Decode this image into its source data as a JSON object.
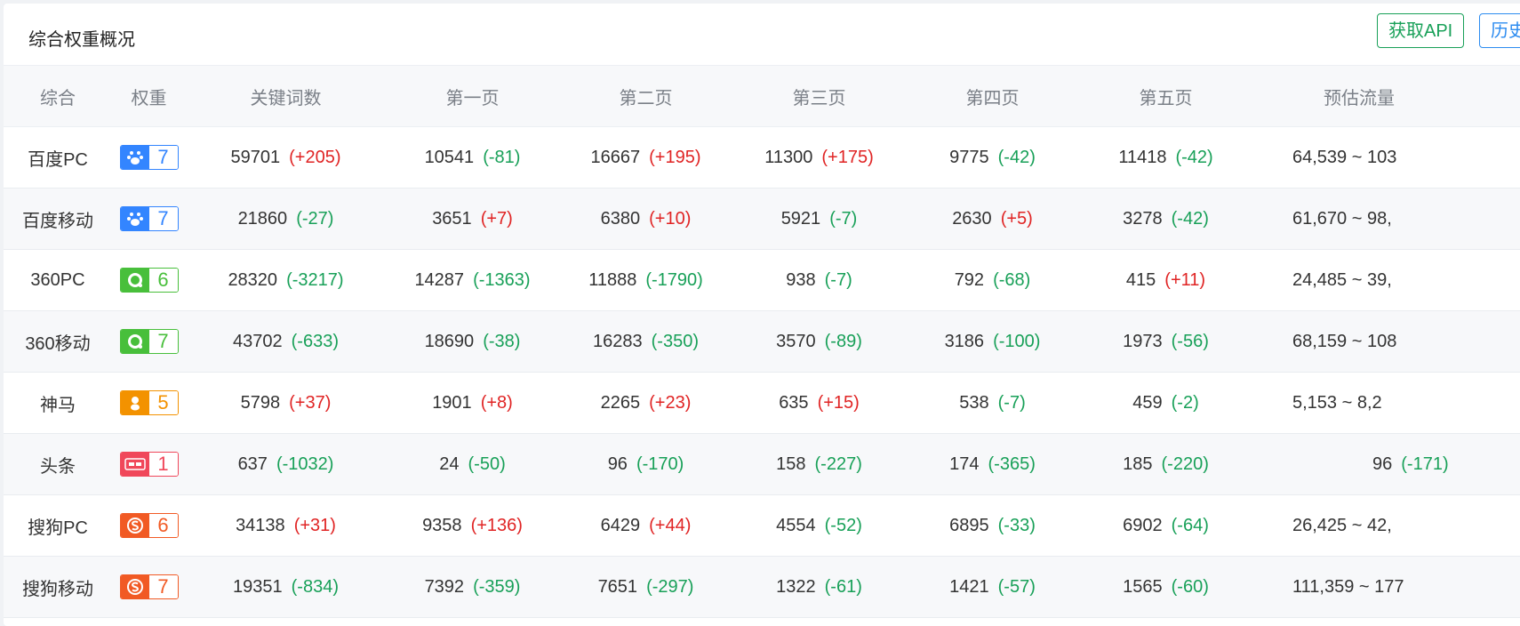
{
  "header": {
    "title": "综合权重概况",
    "api_button": "获取API",
    "history_button": "历史"
  },
  "table": {
    "columns": [
      "综合",
      "权重",
      "关键词数",
      "第一页",
      "第二页",
      "第三页",
      "第四页",
      "第五页",
      "预估流量"
    ],
    "rows": [
      {
        "engine": "百度PC",
        "badge_icon": "baidu-paw-icon",
        "badge_color": "#3385ff",
        "weight": "7",
        "keywords": {
          "v": "59701",
          "d": "(+205)"
        },
        "p1": {
          "v": "10541",
          "d": "(-81)"
        },
        "p2": {
          "v": "16667",
          "d": "(+195)"
        },
        "p3": {
          "v": "11300",
          "d": "(+175)"
        },
        "p4": {
          "v": "9775",
          "d": "(-42)"
        },
        "p5": {
          "v": "11418",
          "d": "(-42)"
        },
        "traffic": {
          "v": "64,539 ~ 103",
          "d": ""
        }
      },
      {
        "engine": "百度移动",
        "badge_icon": "baidu-paw-icon",
        "badge_color": "#3385ff",
        "weight": "7",
        "keywords": {
          "v": "21860",
          "d": "(-27)"
        },
        "p1": {
          "v": "3651",
          "d": "(+7)"
        },
        "p2": {
          "v": "6380",
          "d": "(+10)"
        },
        "p3": {
          "v": "5921",
          "d": "(-7)"
        },
        "p4": {
          "v": "2630",
          "d": "(+5)"
        },
        "p5": {
          "v": "3278",
          "d": "(-42)"
        },
        "traffic": {
          "v": "61,670 ~ 98,",
          "d": ""
        }
      },
      {
        "engine": "360PC",
        "badge_icon": "360-logo-icon",
        "badge_color": "#48bf3b",
        "weight": "6",
        "keywords": {
          "v": "28320",
          "d": "(-3217)"
        },
        "p1": {
          "v": "14287",
          "d": "(-1363)"
        },
        "p2": {
          "v": "11888",
          "d": "(-1790)"
        },
        "p3": {
          "v": "938",
          "d": "(-7)"
        },
        "p4": {
          "v": "792",
          "d": "(-68)"
        },
        "p5": {
          "v": "415",
          "d": "(+11)"
        },
        "traffic": {
          "v": "24,485 ~ 39,",
          "d": ""
        }
      },
      {
        "engine": "360移动",
        "badge_icon": "360-logo-icon",
        "badge_color": "#48bf3b",
        "weight": "7",
        "keywords": {
          "v": "43702",
          "d": "(-633)"
        },
        "p1": {
          "v": "18690",
          "d": "(-38)"
        },
        "p2": {
          "v": "16283",
          "d": "(-350)"
        },
        "p3": {
          "v": "3570",
          "d": "(-89)"
        },
        "p4": {
          "v": "3186",
          "d": "(-100)"
        },
        "p5": {
          "v": "1973",
          "d": "(-56)"
        },
        "traffic": {
          "v": "68,159 ~ 108",
          "d": ""
        }
      },
      {
        "engine": "神马",
        "badge_icon": "shenma-logo-icon",
        "badge_color": "#f39200",
        "weight": "5",
        "keywords": {
          "v": "5798",
          "d": "(+37)"
        },
        "p1": {
          "v": "1901",
          "d": "(+8)"
        },
        "p2": {
          "v": "2265",
          "d": "(+23)"
        },
        "p3": {
          "v": "635",
          "d": "(+15)"
        },
        "p4": {
          "v": "538",
          "d": "(-7)"
        },
        "p5": {
          "v": "459",
          "d": "(-2)"
        },
        "traffic": {
          "v": "5,153 ~ 8,2",
          "d": ""
        }
      },
      {
        "engine": "头条",
        "badge_icon": "toutiao-logo-icon",
        "badge_color": "#f0475a",
        "weight": "1",
        "keywords": {
          "v": "637",
          "d": "(-1032)"
        },
        "p1": {
          "v": "24",
          "d": "(-50)"
        },
        "p2": {
          "v": "96",
          "d": "(-170)"
        },
        "p3": {
          "v": "158",
          "d": "(-227)"
        },
        "p4": {
          "v": "174",
          "d": "(-365)"
        },
        "p5": {
          "v": "185",
          "d": "(-220)"
        },
        "traffic": {
          "v": "96",
          "d": "(-171)"
        }
      },
      {
        "engine": "搜狗PC",
        "badge_icon": "sogou-logo-icon",
        "badge_color": "#f15a24",
        "weight": "6",
        "keywords": {
          "v": "34138",
          "d": "(+31)"
        },
        "p1": {
          "v": "9358",
          "d": "(+136)"
        },
        "p2": {
          "v": "6429",
          "d": "(+44)"
        },
        "p3": {
          "v": "4554",
          "d": "(-52)"
        },
        "p4": {
          "v": "6895",
          "d": "(-33)"
        },
        "p5": {
          "v": "6902",
          "d": "(-64)"
        },
        "traffic": {
          "v": "26,425 ~ 42,",
          "d": ""
        }
      },
      {
        "engine": "搜狗移动",
        "badge_icon": "sogou-logo-icon",
        "badge_color": "#f15a24",
        "weight": "7",
        "keywords": {
          "v": "19351",
          "d": "(-834)"
        },
        "p1": {
          "v": "7392",
          "d": "(-359)"
        },
        "p2": {
          "v": "7651",
          "d": "(-297)"
        },
        "p3": {
          "v": "1322",
          "d": "(-61)"
        },
        "p4": {
          "v": "1421",
          "d": "(-57)"
        },
        "p5": {
          "v": "1565",
          "d": "(-60)"
        },
        "traffic": {
          "v": "111,359 ~ 177",
          "d": ""
        }
      }
    ]
  }
}
